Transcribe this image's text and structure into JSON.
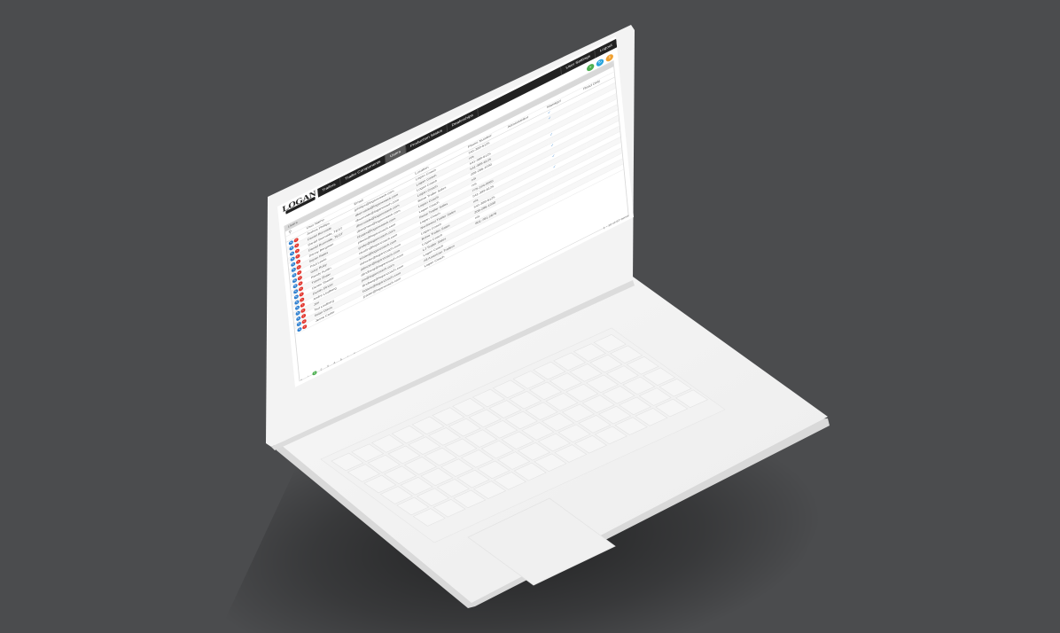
{
  "app": {
    "logo_text": "LOGAN",
    "nav": [
      "Trailers",
      "Trailer Components",
      "Users",
      "Production Status",
      "Dealerships"
    ],
    "nav_active_index": 2,
    "nav_right": [
      "User Settings",
      "Logout"
    ]
  },
  "actions": [
    {
      "name": "add-icon",
      "glyph": "+",
      "color": "#4caf50"
    },
    {
      "name": "refresh-icon",
      "glyph": "↻",
      "color": "#29a3dc"
    },
    {
      "name": "export-icon",
      "glyph": "⇩",
      "color": "#f0a030"
    }
  ],
  "panel": {
    "title": "Users",
    "search_icon": "search-icon"
  },
  "table": {
    "columns": [
      "",
      "User Name",
      "Email",
      "Location",
      "Phone Number",
      "Administrator",
      "Manager",
      "Read Only"
    ],
    "rows": [
      [
        "",
        "Joshua Phillips",
        "jphillips@logancoach.com",
        "Logan Coach",
        "541-389-6125",
        "",
        "✓",
        ""
      ],
      [
        "",
        "Daniel Burnside",
        "dburnside@logancoach.com",
        "Logan Coach",
        "n/a",
        "",
        "✓",
        ""
      ],
      [
        "",
        "Daniel Burnside_TEST",
        "dburnside@logancoach.com",
        "Logan Coach",
        "541-389-6125",
        "",
        "",
        ""
      ],
      [
        "",
        "Daniel Burnside_TEST",
        "dburnside@logancoach.com",
        "Logan Coach",
        "541-389-6125",
        "",
        "",
        ""
      ],
      [
        "",
        "Danny Bergman",
        "dbergman@logancoach.com",
        "Boise Trailer Sales",
        "208-286-1030",
        "",
        "✓",
        ""
      ],
      [
        "",
        "Bryan Bates",
        "bbates@logancoach.com",
        "Logan Coach",
        "n/a",
        "",
        "",
        ""
      ],
      [
        "",
        "Paul Lewis",
        "plewis@logancoach.com",
        "Logan Coach",
        "n/a",
        "",
        "✓",
        ""
      ],
      [
        "",
        "Gary Ruby",
        "gruby@logancoach.com",
        "Boise Trailer Sales",
        "775-224-0065",
        "",
        "",
        ""
      ],
      [
        "",
        "Randy Austin",
        "raustin@logancoach.com",
        "Logan Coach",
        "541-389-6125",
        "",
        "✓",
        ""
      ],
      [
        "",
        "Travis Shaw",
        "tshaw@logancoach.com",
        "Northwest Trailer Sales",
        "n/a",
        "",
        "",
        ""
      ],
      [
        "",
        "Dustin Shorter",
        "dshorter@logancoach.com",
        "Logan Coach",
        "541-389-6125",
        "",
        "✓",
        ""
      ],
      [
        "",
        "Dustin Dincer",
        "ddincer@logancoach.com",
        "Boise Trailer Sales",
        "208-286-1030",
        "",
        "",
        ""
      ],
      [
        "",
        "Andre Lindberg",
        "alindberg@logancoach.com",
        "Logan Coach",
        "n/a",
        "",
        "",
        ""
      ],
      [
        "",
        "Jim",
        "jim@logancoach.com",
        "LJ Trailer Sales",
        "801-781-2676",
        "",
        "",
        ""
      ],
      [
        "",
        "Ted Lindberg",
        "tlindberg@logancoach.com",
        "Logan Coach",
        "",
        "",
        "",
        ""
      ],
      [
        "",
        "Brian Davis",
        "bdavis@logancoach.com",
        "All American Trailers",
        "",
        "",
        "",
        ""
      ],
      [
        "",
        "Jesse Carter",
        "jcarter@logancoach.com",
        "Logan Coach",
        "",
        "",
        "",
        ""
      ]
    ]
  },
  "pager": {
    "prev": [
      "«",
      "‹"
    ],
    "pages": [
      "1",
      "2",
      "3",
      "4",
      "5"
    ],
    "current_index": 0,
    "next": [
      "›",
      "»"
    ],
    "info": "1 - 10 of 67 items"
  }
}
